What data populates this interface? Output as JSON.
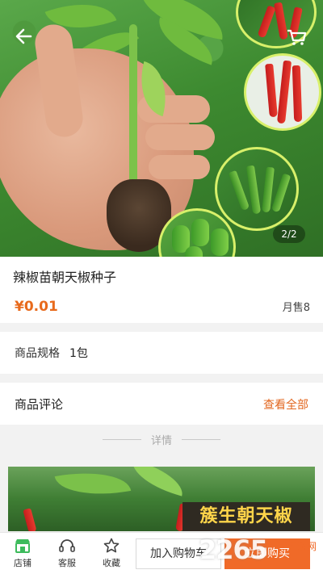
{
  "hero": {
    "page_indicator": "2/2",
    "back_icon": "arrow-left-icon",
    "cart_icon": "shopping-cart-icon"
  },
  "product": {
    "title": "辣椒苗朝天椒种子",
    "price": "¥0.01",
    "monthly_sales": "月售8"
  },
  "spec": {
    "label": "商品规格",
    "value": "1包"
  },
  "reviews": {
    "label": "商品评论",
    "view_all": "查看全部"
  },
  "details": {
    "divider_label": "详情",
    "banner_text": "簇生朝天椒"
  },
  "bottom_bar": {
    "shop_label": "店铺",
    "service_label": "客服",
    "favorite_label": "收藏",
    "add_to_cart_label": "加入购物车",
    "buy_now_label": "立即购买"
  },
  "watermark": {
    "number": "2265",
    "site": "手游网"
  },
  "colors": {
    "accent": "#f06a28",
    "price": "#e86a1c",
    "shop_icon": "#3dbb5c"
  }
}
